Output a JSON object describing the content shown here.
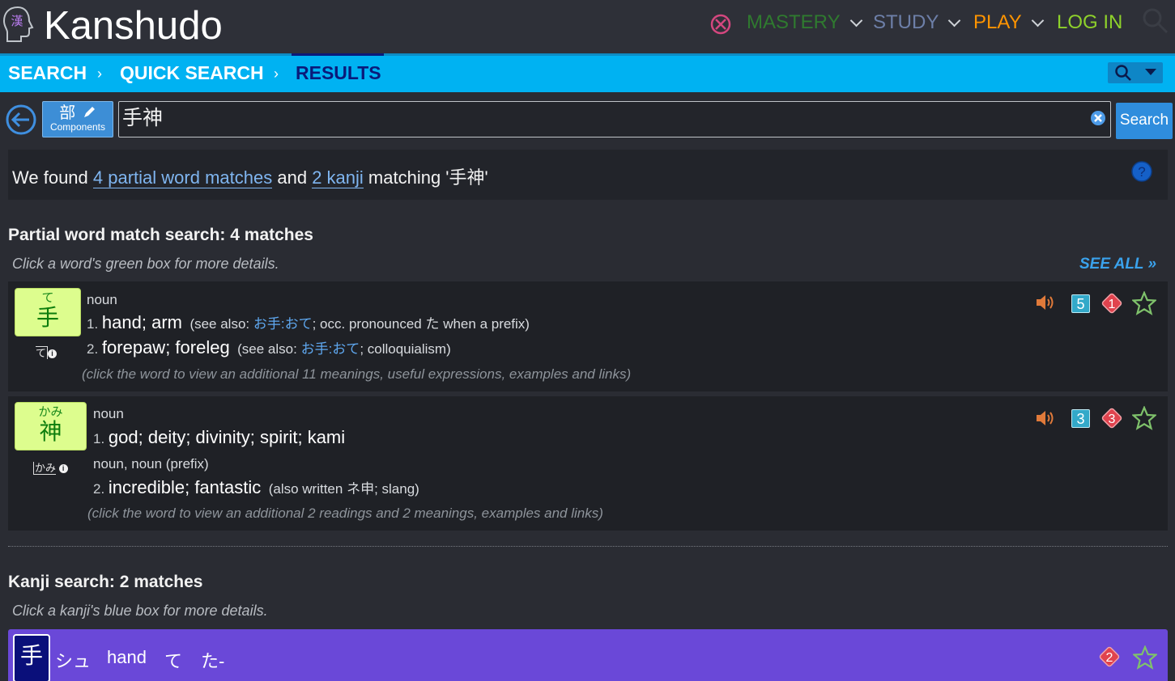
{
  "header": {
    "logo_glyph": "漢",
    "app_name": "Kanshudo",
    "nav": {
      "mastery": "MASTERY",
      "study": "STUDY",
      "play": "PLAY",
      "login": "LOG IN"
    }
  },
  "breadcrumb": {
    "items": [
      "SEARCH",
      "QUICK SEARCH",
      "RESULTS"
    ],
    "separator": "›"
  },
  "search": {
    "components_glyph": "部",
    "components_label": "Components",
    "query": "手神",
    "button_label": "Search"
  },
  "summary": {
    "prefix": "We found",
    "words_link": "4 partial word matches",
    "and": "and",
    "kanji_link": "2 kanji",
    "suffix": "matching '手神'"
  },
  "word_section": {
    "title": "Partial word match search: 4 matches",
    "hint": "Click a word's green box for more details.",
    "see_all": "SEE ALL »",
    "entries": [
      {
        "furigana": "て",
        "word": "手",
        "pitch": "て",
        "pos": "noun",
        "meanings": [
          {
            "num": "1.",
            "gloss": "hand; arm",
            "note_open": "(see also: ",
            "note_link": "お手:おて",
            "note_rest": "; occ. pronounced た when a prefix)"
          },
          {
            "num": "2.",
            "gloss": "forepaw; foreleg",
            "note_open": "(see also: ",
            "note_link": "お手:おて",
            "note_rest": "; colloquialism)"
          }
        ],
        "more": "(click the word to view an additional 11 meanings, useful expressions, examples and links)",
        "jlpt": "5",
        "freq": "1"
      },
      {
        "furigana": "かみ",
        "word": "神",
        "pitch": "かみ",
        "pos": "noun",
        "pos2": "noun, noun (prefix)",
        "meanings": [
          {
            "num": "1.",
            "gloss": "god; deity; divinity; spirit; kami"
          },
          {
            "num": "2.",
            "gloss": "incredible; fantastic",
            "note": "(also written ネ申; slang)"
          }
        ],
        "more": "(click the word to view an additional 2 readings and 2 meanings, examples and links)",
        "jlpt": "3",
        "freq": "3"
      }
    ]
  },
  "kanji_section": {
    "title": "Kanji search: 2 matches",
    "hint": "Click a kanji's blue box for more details.",
    "entries": [
      {
        "kanji": "手",
        "on": "シュ",
        "meaning": "hand",
        "kun1": "て",
        "kun2": "た-",
        "freq": "2"
      }
    ]
  },
  "colors": {
    "accent_blue": "#00b2f2",
    "word_box": "#ddfd8e",
    "kanji_row": "#6a48d8",
    "mastery": "#2f7a2f",
    "play": "#ff9400",
    "login": "#8ed12b",
    "freq_badge": "#e0434e",
    "jlpt_badge": "#33a9c9"
  }
}
